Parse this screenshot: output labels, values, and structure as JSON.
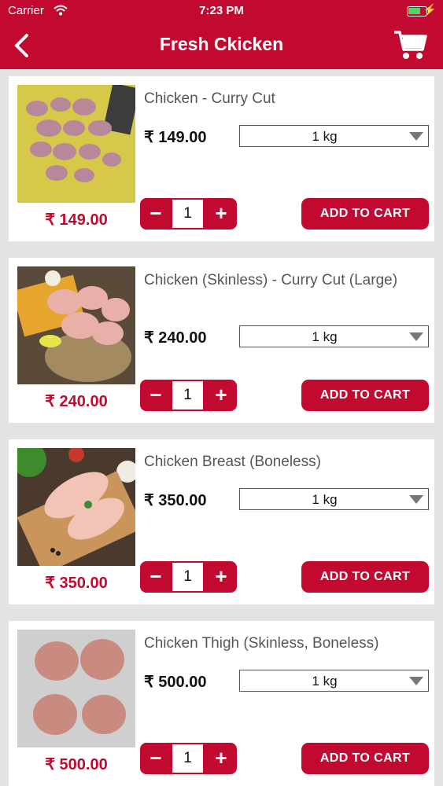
{
  "status_bar": {
    "carrier": "Carrier",
    "time": "7:23 PM",
    "battery_level": 0.7,
    "charging_symbol": "⚡"
  },
  "header": {
    "title": "Fresh Ckicken",
    "back_icon": "chevron-left-icon",
    "cart_icon": "cart-icon",
    "background": "#c2092f"
  },
  "products": [
    {
      "name": "Chicken - Curry Cut",
      "price": "₹ 149.00",
      "image_price": "₹ 149.00",
      "weight": "1 kg",
      "quantity": "1",
      "add_label": "ADD TO CART"
    },
    {
      "name": "Chicken (Skinless) - Curry Cut (Large)",
      "price": "₹ 240.00",
      "image_price": "₹ 240.00",
      "weight": "1 kg",
      "quantity": "1",
      "add_label": "ADD TO CART"
    },
    {
      "name": "Chicken Breast (Boneless)",
      "price": "₹ 350.00",
      "image_price": "₹ 350.00",
      "weight": "1 kg",
      "quantity": "1",
      "add_label": "ADD TO CART"
    },
    {
      "name": "Chicken Thigh (Skinless, Boneless)",
      "price": "₹ 500.00",
      "image_price": "₹ 500.00",
      "weight": "1 kg",
      "quantity": "1",
      "add_label": "ADD TO CART"
    }
  ],
  "stepper": {
    "minus": "−",
    "plus": "+"
  }
}
